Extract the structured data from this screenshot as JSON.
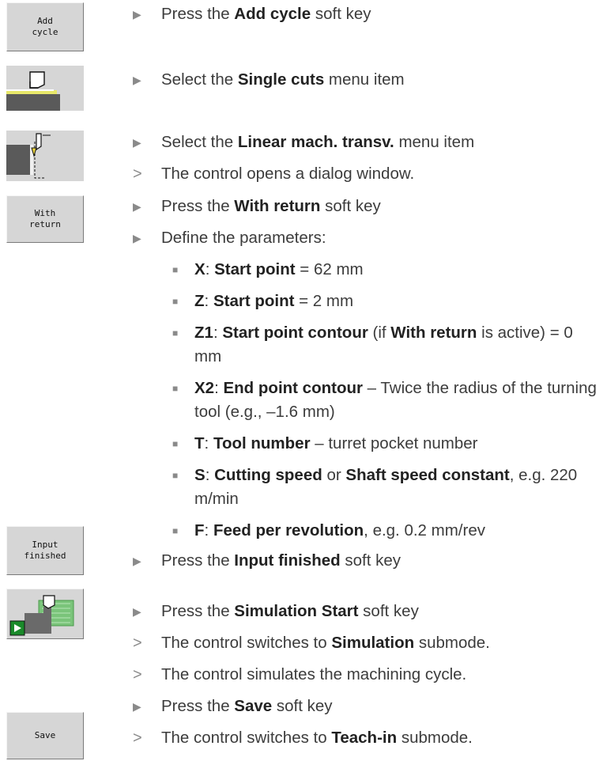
{
  "softkeys": {
    "add_cycle": "Add\ncycle",
    "with_return": "With\nreturn",
    "input_finished": "Input\nfinished",
    "save": "Save"
  },
  "steps": {
    "s1": {
      "pre": "Press the ",
      "b1": "Add cycle",
      "post": " soft key"
    },
    "s2": {
      "pre": "Select the ",
      "b1": "Single cuts",
      "post": " menu item"
    },
    "s3": {
      "pre": "Select the ",
      "b1": "Linear mach. transv.",
      "post": " menu item"
    },
    "s4": {
      "text": "The control opens a dialog window."
    },
    "s5": {
      "pre": "Press the ",
      "b1": "With return",
      "post": " soft key"
    },
    "s6": {
      "text": "Define the parameters:"
    },
    "p1": {
      "b0": "X",
      "mid": ": ",
      "b1": "Start point",
      "post": " = 62 mm"
    },
    "p2": {
      "b0": "Z",
      "mid": ": ",
      "b1": "Start point",
      "post": " = 2 mm"
    },
    "p3": {
      "b0": "Z1",
      "mid": ": ",
      "b1": "Start point contour",
      "mid2": " (if ",
      "b2": "With return",
      "post": " is active) = 0 mm"
    },
    "p4": {
      "b0": "X2",
      "mid": ": ",
      "b1": "End point contour",
      "post": " – Twice the radius of the turning tool (e.g., –1.6 mm)"
    },
    "p5": {
      "b0": "T",
      "mid": ": ",
      "b1": "Tool number",
      "post": " – turret pocket number"
    },
    "p6": {
      "b0": "S",
      "mid": ": ",
      "b1": "Cutting speed",
      "mid2": " or ",
      "b2": "Shaft speed constant",
      "post": ", e.g. 220 m/min"
    },
    "p7": {
      "b0": "F",
      "mid": ": ",
      "b1": "Feed per revolution",
      "post": ", e.g. 0.2 mm/rev"
    },
    "s7": {
      "pre": "Press the ",
      "b1": "Input finished",
      "post": " soft key"
    },
    "s8": {
      "pre": "Press the ",
      "b1": "Simulation Start",
      "post": " soft key"
    },
    "s9": {
      "pre": "The control switches to ",
      "b1": "Simulation",
      "post": " submode."
    },
    "s10": {
      "text": "The control simulates the machining cycle."
    },
    "s11": {
      "pre": "Press the ",
      "b1": "Save",
      "post": " soft key"
    },
    "s12": {
      "pre": "The control switches to ",
      "b1": "Teach-in",
      "post": " submode."
    }
  },
  "markers": {
    "action": "▶",
    "result": ">",
    "bullet": "■"
  },
  "icons": {
    "single_cuts": "single-cuts-icon",
    "linear_transv": "linear-mach-transv-icon",
    "simulation_start": "simulation-start-icon"
  },
  "colors": {
    "softkey_bg": "#d6d6d6",
    "text": "#3c3c3c",
    "marker": "#8a8a8a"
  }
}
